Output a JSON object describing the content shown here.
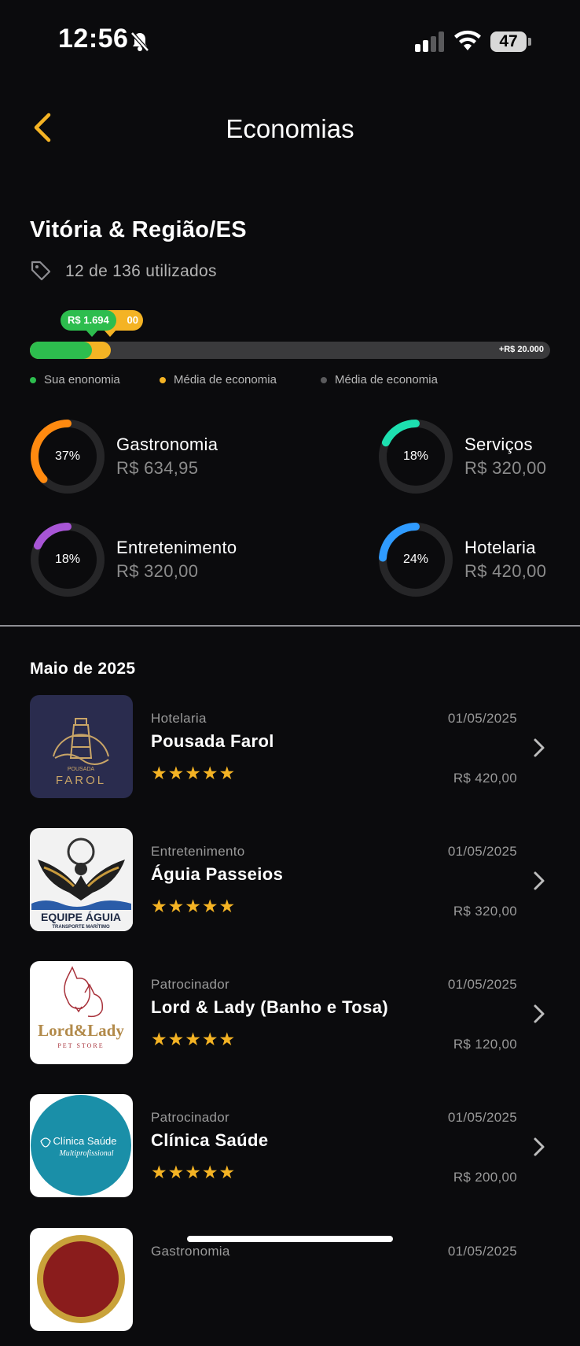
{
  "status": {
    "time": "12:56",
    "battery": "47"
  },
  "header": {
    "title": "Economias"
  },
  "region": {
    "name": "Vitória & Região/ES",
    "used": "12 de 136 utilizados"
  },
  "progress": {
    "you_label": "R$ 1.694",
    "avg_label_visible": "00",
    "max_label": "+R$ 20.000",
    "you_fraction": 0.12,
    "avg_fraction": 0.155,
    "colors": {
      "you": "#2dbd4e",
      "avg": "#f4b324",
      "track": "#3a3a3c"
    }
  },
  "legend": [
    {
      "label": "Sua enonomia",
      "color": "#2dbd4e"
    },
    {
      "label": "Média de economia",
      "color": "#f4b324"
    },
    {
      "label": "Média de economia",
      "color": "#5a5a5c"
    }
  ],
  "categories": [
    {
      "pct_label": "37%",
      "fraction": 0.37,
      "name": "Gastronomia",
      "value": "R$ 634,95",
      "color": "#ff8a10"
    },
    {
      "pct_label": "18%",
      "fraction": 0.18,
      "name": "Serviços",
      "value": "R$ 320,00",
      "color": "#1de0b0"
    },
    {
      "pct_label": "18%",
      "fraction": 0.18,
      "name": "Entretenimento",
      "value": "R$ 320,00",
      "color": "#a855d6"
    },
    {
      "pct_label": "24%",
      "fraction": 0.24,
      "name": "Hotelaria",
      "value": "R$ 420,00",
      "color": "#2f9bff"
    }
  ],
  "month": "Maio de 2025",
  "items": [
    {
      "category": "Hotelaria",
      "date": "01/05/2025",
      "name": "Pousada Farol",
      "stars": "★★★★★",
      "value": "R$ 420,00",
      "logo_text": "FAROL",
      "logo_small": "POUSADA"
    },
    {
      "category": "Entretenimento",
      "date": "01/05/2025",
      "name": "Águia Passeios",
      "stars": "★★★★★",
      "value": "R$ 320,00",
      "logo_text": "EQUIPE ÁGUIA",
      "logo_small": "TRANSPORTE MARÍTIMO"
    },
    {
      "category": "Patrocinador",
      "date": "01/05/2025",
      "name": "Lord & Lady (Banho e Tosa)",
      "stars": "★★★★★",
      "value": "R$ 120,00",
      "logo_text": "Lord&Lady",
      "logo_small": "PET STORE"
    },
    {
      "category": "Patrocinador",
      "date": "01/05/2025",
      "name": "Clínica Saúde",
      "stars": "★★★★★",
      "value": "R$ 200,00",
      "logo_text": "Clínica Saúde",
      "logo_small": "Multiprofissional"
    },
    {
      "category": "Gastronomia",
      "date": "01/05/2025"
    }
  ]
}
